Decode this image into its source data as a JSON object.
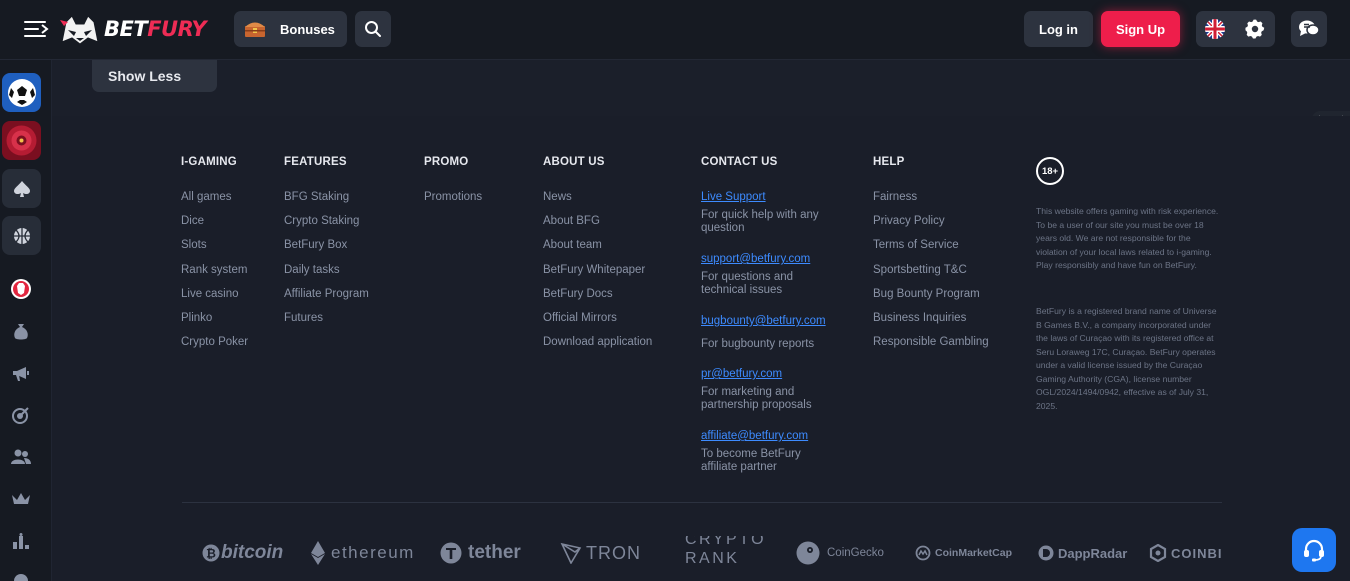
{
  "header": {
    "logo_text_white": "BET",
    "logo_text_red": "FURY",
    "bonuses_label": "Bonuses",
    "login_label": "Log in",
    "signup_label": "Sign Up"
  },
  "show_less_label": "Show Less",
  "footer": {
    "columns": [
      {
        "title": "I-GAMING",
        "items": [
          "All games",
          "Dice",
          "Slots",
          "Rank system",
          "Live casino",
          "Plinko",
          "Crypto Poker"
        ]
      },
      {
        "title": "FEATURES",
        "items": [
          "BFG Staking",
          "Crypto Staking",
          "BetFury Box",
          "Daily tasks",
          "Affiliate Program",
          "Futures"
        ]
      },
      {
        "title": "PROMO",
        "items": [
          "Promotions"
        ]
      },
      {
        "title": "ABOUT US",
        "items": [
          "News",
          "About BFG",
          "About team",
          "BetFury Whitepaper",
          "BetFury Docs",
          "Official Mirrors",
          "Download application"
        ]
      }
    ],
    "contact": {
      "title": "CONTACT US",
      "items": [
        {
          "link": "Live Support",
          "desc": [
            "For quick help with any",
            "question"
          ]
        },
        {
          "link": "support@betfury.com",
          "desc": [
            "For questions and",
            "technical issues"
          ]
        },
        {
          "link": "bugbounty@betfury.com",
          "desc": [
            "For bugbounty reports"
          ]
        },
        {
          "link": "pr@betfury.com",
          "desc": [
            "For marketing and",
            "partnership proposals"
          ]
        },
        {
          "link": "affiliate@betfury.com",
          "desc": [
            "To become BetFury",
            "affiliate partner"
          ]
        }
      ]
    },
    "help": {
      "title": "HELP",
      "items": [
        "Fairness",
        "Privacy Policy",
        "Terms of Service",
        "Sportsbetting T&C",
        "Bug Bounty Program",
        "Business Inquiries",
        "Responsible Gambling"
      ]
    },
    "age_badge": "18+",
    "legal_1": "This website offers gaming with risk experience. To be a user of our site you must be over 18 years old. We are not responsible for the violation of your local laws related to i-gaming. Play responsibly and have fun on BetFury.",
    "legal_2": "BetFury is a registered brand name of Universe B Games B.V., a company incorporated under the laws of Curaçao with its registered office at Seru Loraweg 17C, Curaçao. BetFury operates under a valid license issued by the Curaçao Gaming Authority (CGA), license number OGL/2024/1494/0942, effective as of July 31, 2025.",
    "partners": {
      "bitcoin": "bitcoin",
      "ethereum": "ethereum",
      "tether": "tether",
      "tron": "TRON",
      "cryptorank_1": "CRYPTO",
      "cryptorank_2": "RANK",
      "coingecko": "CoinGecko",
      "coinmarketcap": "CoinMarketCap",
      "dappradar": "DappRadar",
      "coinbase": "COINBI"
    }
  },
  "colors": {
    "accent": "#ee1e4b",
    "link": "#3d8bff",
    "support": "#1e77f0",
    "background": "#1b1f2a"
  }
}
